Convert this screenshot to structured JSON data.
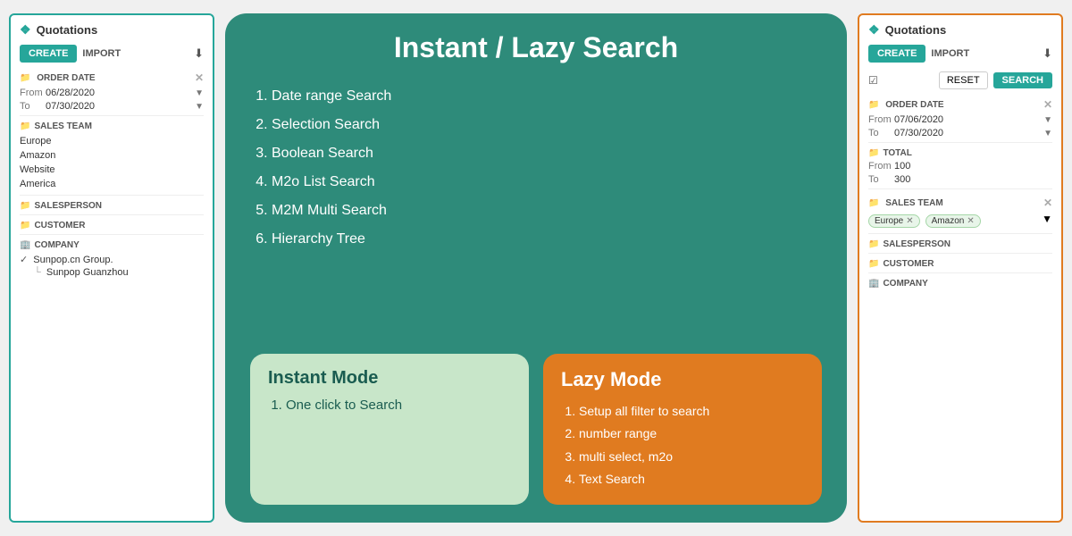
{
  "left_panel": {
    "header": "Quotations",
    "create_label": "CREATE",
    "import_label": "IMPORT",
    "download_icon": "⬇",
    "order_date": {
      "label": "ORDER DATE",
      "from_label": "From",
      "from_value": "06/28/2020",
      "to_label": "To",
      "to_value": "07/30/2020"
    },
    "sales_team": {
      "label": "SALES TEAM",
      "items": [
        "Europe",
        "Amazon",
        "Website",
        "America"
      ]
    },
    "salesperson_label": "SALESPERSON",
    "customer_label": "CUSTOMER",
    "company_label": "COMPANY",
    "company_items": [
      {
        "label": "✓ Sunpop.cn Group.",
        "indent": false
      },
      {
        "label": "└ Sunpop Guanzhou",
        "indent": true
      }
    ]
  },
  "right_panel": {
    "header": "Quotations",
    "create_label": "CREATE",
    "import_label": "IMPORT",
    "download_icon": "⬇",
    "reset_label": "RESET",
    "search_label": "SEARCH",
    "order_date": {
      "label": "ORDER DATE",
      "from_label": "From",
      "from_value": "07/06/2020",
      "to_label": "To",
      "to_value": "07/30/2020"
    },
    "total": {
      "label": "TOTAL",
      "from_label": "From",
      "from_value": "100",
      "to_label": "To",
      "to_value": "300"
    },
    "sales_team": {
      "label": "SALES TEAM",
      "tags": [
        "Europe",
        "Amazon"
      ]
    },
    "salesperson_label": "SALESPERSON",
    "customer_label": "CUSTOMER",
    "company_label": "COMPANY"
  },
  "center": {
    "title": "Instant / Lazy Search",
    "list_items": [
      "Date range Search",
      "Selection Search",
      "Boolean Search",
      "M2o List Search",
      "M2M Multi Search",
      "Hierarchy Tree"
    ],
    "instant_mode": {
      "title": "Instant Mode",
      "items": [
        "One click to Search"
      ]
    },
    "lazy_mode": {
      "title": "Lazy Mode",
      "items": [
        "Setup all filter to search",
        "number range",
        "multi select, m2o",
        "Text Search"
      ]
    }
  }
}
